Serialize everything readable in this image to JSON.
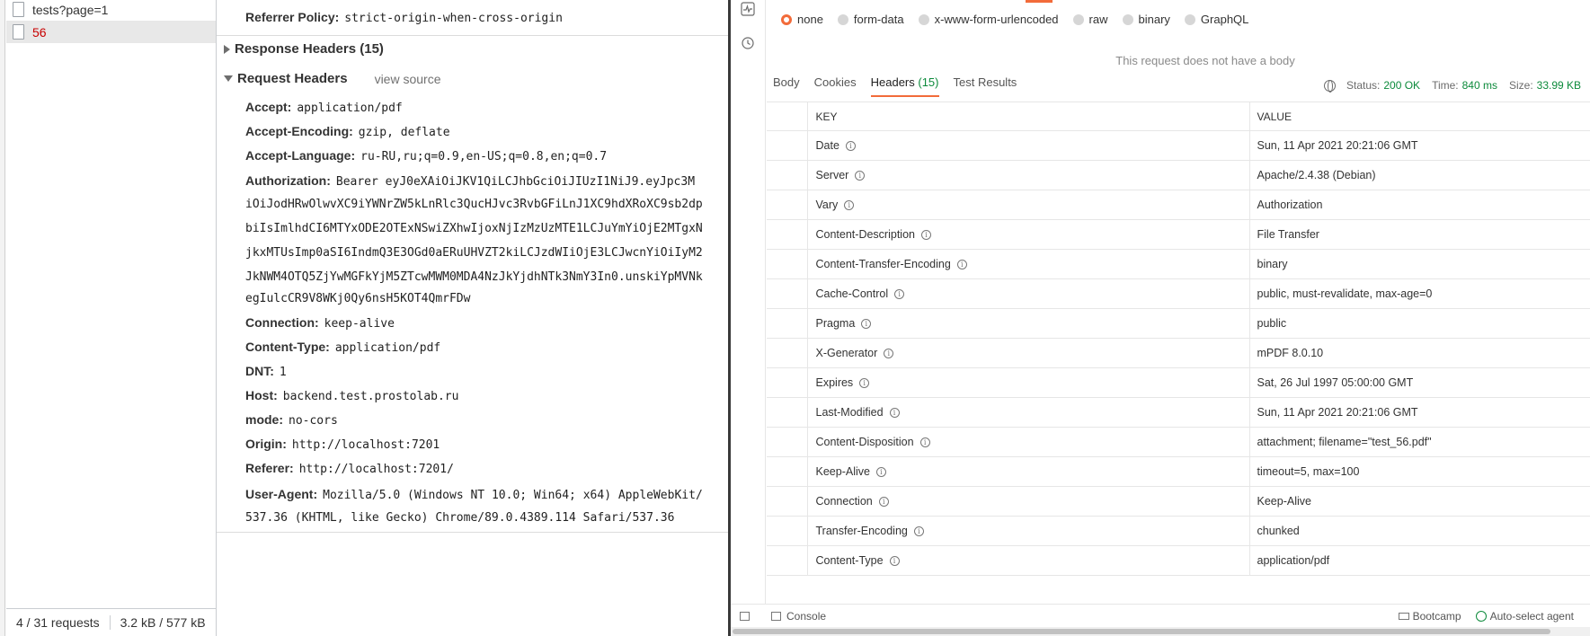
{
  "network_list": {
    "requests": [
      {
        "name": "tests?page=1",
        "selected": false,
        "error": false
      },
      {
        "name": "56",
        "selected": true,
        "error": true
      }
    ],
    "status": {
      "requests": "4 / 31 requests",
      "transferred": "3.2 kB / 577 kB"
    }
  },
  "headers_panel": {
    "referrer_policy": {
      "key": "Referrer Policy:",
      "value": "strict-origin-when-cross-origin"
    },
    "response_headers_title": "Response Headers (15)",
    "request_headers_title": "Request Headers",
    "view_source": "view source",
    "request_headers": [
      {
        "key": "Accept:",
        "value": "application/pdf"
      },
      {
        "key": "Accept-Encoding:",
        "value": "gzip, deflate"
      },
      {
        "key": "Accept-Language:",
        "value": "ru-RU,ru;q=0.9,en-US;q=0.8,en;q=0.7"
      },
      {
        "key": "Authorization:",
        "value": "Bearer eyJ0eXAiOiJKV1QiLCJhbGciOiJIUzI1NiJ9.eyJpc3M"
      }
    ],
    "authorization_continued": [
      "iOiJodHRwOlwvXC9iYWNrZW5kLnRlc3QucHJvc3RvbGFiLnJ1XC9hdXRoXC9sb2dp",
      "biIsImlhdCI6MTYxODE2OTExNSwiZXhwIjoxNjIzMzUzMTE1LCJuYmYiOjE2MTgxN",
      "jkxMTUsImp0aSI6IndmQ3E3OGd0aERuUHVZT2kiLCJzdWIiOjE3LCJwcnYiOiIyM2",
      "JkNWM4OTQ5ZjYwMGFkYjM5ZTcwMWM0MDA4NzJkYjdhNTk3NmY3In0.unskiYpMVNk",
      "egIulcCR9V8WKj0Qy6nsH5KOT4QmrFDw"
    ],
    "request_headers_2": [
      {
        "key": "Connection:",
        "value": "keep-alive"
      },
      {
        "key": "Content-Type:",
        "value": "application/pdf"
      },
      {
        "key": "DNT:",
        "value": "1"
      },
      {
        "key": "Host:",
        "value": "backend.test.prostolab.ru"
      },
      {
        "key": "mode:",
        "value": "no-cors"
      },
      {
        "key": "Origin:",
        "value": "http://localhost:7201"
      },
      {
        "key": "Referer:",
        "value": "http://localhost:7201/"
      },
      {
        "key": "User-Agent:",
        "value": "Mozilla/5.0 (Windows NT 10.0; Win64; x64) AppleWebKit/"
      }
    ],
    "user_agent_continued": "537.36 (KHTML, like Gecko) Chrome/89.0.4389.114 Safari/537.36"
  },
  "postman": {
    "body_options": [
      "none",
      "form-data",
      "x-www-form-urlencoded",
      "raw",
      "binary",
      "GraphQL"
    ],
    "no_body_text": "This request does not have a body",
    "tabs": {
      "body": "Body",
      "cookies": "Cookies",
      "headers": "Headers",
      "headers_count": "(15)",
      "test_results": "Test Results"
    },
    "meta": {
      "status_label": "Status:",
      "status": "200 OK",
      "time_label": "Time:",
      "time": "840 ms",
      "size_label": "Size:",
      "size": "33.99 KB"
    },
    "table": {
      "key_header": "KEY",
      "value_header": "VALUE",
      "rows": [
        {
          "key": "Date",
          "value": "Sun, 11 Apr 2021 20:21:06 GMT"
        },
        {
          "key": "Server",
          "value": "Apache/2.4.38 (Debian)"
        },
        {
          "key": "Vary",
          "value": "Authorization"
        },
        {
          "key": "Content-Description",
          "value": "File Transfer"
        },
        {
          "key": "Content-Transfer-Encoding",
          "value": "binary"
        },
        {
          "key": "Cache-Control",
          "value": "public, must-revalidate, max-age=0"
        },
        {
          "key": "Pragma",
          "value": "public"
        },
        {
          "key": "X-Generator",
          "value": "mPDF 8.0.10"
        },
        {
          "key": "Expires",
          "value": "Sat, 26 Jul 1997 05:00:00 GMT"
        },
        {
          "key": "Last-Modified",
          "value": "Sun, 11 Apr 2021 20:21:06 GMT"
        },
        {
          "key": "Content-Disposition",
          "value": "attachment; filename=\"test_56.pdf\""
        },
        {
          "key": "Keep-Alive",
          "value": "timeout=5, max=100"
        },
        {
          "key": "Connection",
          "value": "Keep-Alive"
        },
        {
          "key": "Transfer-Encoding",
          "value": "chunked"
        },
        {
          "key": "Content-Type",
          "value": "application/pdf"
        }
      ]
    },
    "footer": {
      "console": "Console",
      "bootcamp": "Bootcamp",
      "auto_select": "Auto-select agent"
    }
  }
}
